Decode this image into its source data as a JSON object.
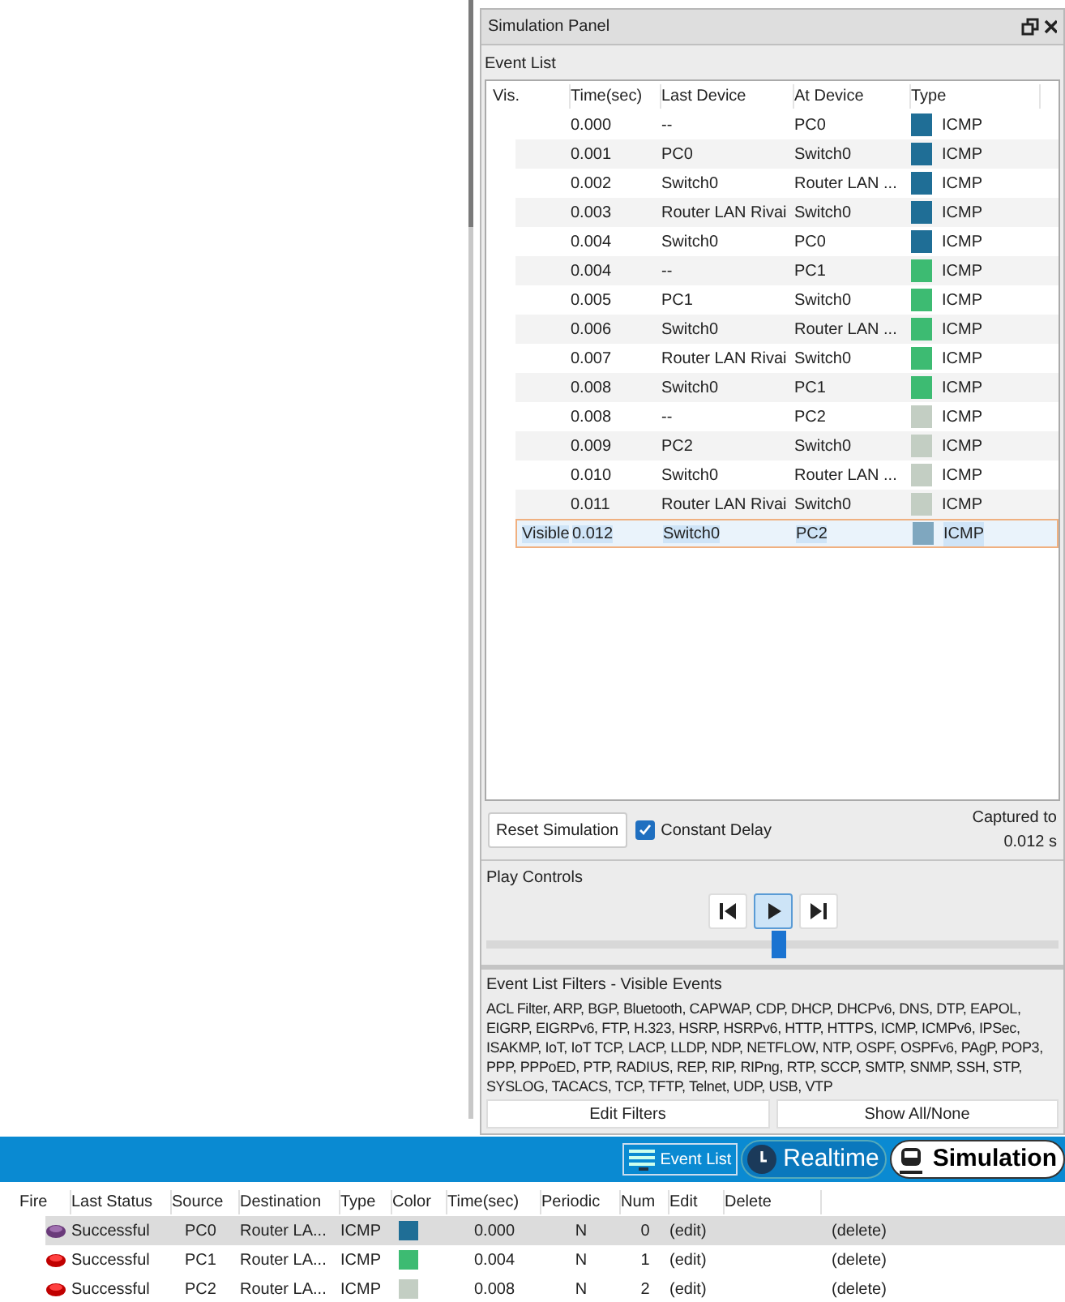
{
  "panel": {
    "title": "Simulation Panel"
  },
  "event_list": {
    "title": "Event List",
    "columns": [
      "Vis.",
      "Time(sec)",
      "Last Device",
      "At Device",
      "Type"
    ],
    "rows": [
      {
        "time": "0.000",
        "last": "--",
        "at": "PC0",
        "color": "#1f6e96",
        "type": "ICMP",
        "selected": false
      },
      {
        "time": "0.001",
        "last": "PC0",
        "at": "Switch0",
        "color": "#1f6e96",
        "type": "ICMP",
        "selected": false
      },
      {
        "time": "0.002",
        "last": "Switch0",
        "at": "Router LAN ...",
        "color": "#1f6e96",
        "type": "ICMP",
        "selected": false
      },
      {
        "time": "0.003",
        "last": "Router LAN Rivai",
        "at": "Switch0",
        "color": "#1f6e96",
        "type": "ICMP",
        "selected": false
      },
      {
        "time": "0.004",
        "last": "Switch0",
        "at": "PC0",
        "color": "#1f6e96",
        "type": "ICMP",
        "selected": false
      },
      {
        "time": "0.004",
        "last": "--",
        "at": "PC1",
        "color": "#3dbb72",
        "type": "ICMP",
        "selected": false
      },
      {
        "time": "0.005",
        "last": "PC1",
        "at": "Switch0",
        "color": "#3dbb72",
        "type": "ICMP",
        "selected": false
      },
      {
        "time": "0.006",
        "last": "Switch0",
        "at": "Router LAN ...",
        "color": "#3dbb72",
        "type": "ICMP",
        "selected": false
      },
      {
        "time": "0.007",
        "last": "Router LAN Rivai",
        "at": "Switch0",
        "color": "#3dbb72",
        "type": "ICMP",
        "selected": false
      },
      {
        "time": "0.008",
        "last": "Switch0",
        "at": "PC1",
        "color": "#3dbb72",
        "type": "ICMP",
        "selected": false
      },
      {
        "time": "0.008",
        "last": "--",
        "at": "PC2",
        "color": "#c3cec3",
        "type": "ICMP",
        "selected": false
      },
      {
        "time": "0.009",
        "last": "PC2",
        "at": "Switch0",
        "color": "#c3cec3",
        "type": "ICMP",
        "selected": false
      },
      {
        "time": "0.010",
        "last": "Switch0",
        "at": "Router LAN ...",
        "color": "#c3cec3",
        "type": "ICMP",
        "selected": false
      },
      {
        "time": "0.011",
        "last": "Router LAN Rivai",
        "at": "Switch0",
        "color": "#c3cec3",
        "type": "ICMP",
        "selected": false
      },
      {
        "vis": "Visible",
        "time": "0.012",
        "last": "Switch0",
        "at": "PC2",
        "color": "#7fa7bf",
        "type": "ICMP",
        "selected": true
      }
    ]
  },
  "reset_button": "Reset Simulation",
  "constant_delay": {
    "label": "Constant Delay",
    "checked": true
  },
  "captured": [
    "Captured to",
    "0.012 s"
  ],
  "play_controls": {
    "title": "Play Controls",
    "buttons": [
      {
        "kind": "back",
        "selected": false
      },
      {
        "kind": "play",
        "selected": true
      },
      {
        "kind": "forward",
        "selected": false
      }
    ],
    "level": 0.51
  },
  "filters": {
    "title": "Event List Filters - Visible Events",
    "text": "ACL Filter, ARP, BGP, Bluetooth, CAPWAP, CDP, DHCP, DHCPv6, DNS, DTP, EAPOL, EIGRP, EIGRPv6, FTP, H.323, HSRP, HSRPv6, HTTP, HTTPS, ICMP, ICMPv6, IPSec, ISAKMP, IoT, IoT TCP, LACP, LLDP, NDP, NETFLOW, NTP, OSPF, OSPFv6, PAgP, POP3, PPP, PPPoED, PTP, RADIUS, REP, RIP, RIPng, RTP, SCCP, SMTP, SNMP, SSH, STP, SYSLOG, TACACS, TCP, TFTP, Telnet, UDP, USB, VTP",
    "buttons": [
      "Edit Filters",
      "Show All/None"
    ]
  },
  "mode_bar": {
    "event_list_button": "Event List",
    "tabs": [
      {
        "label": "Realtime",
        "kind": "realtime",
        "selected": false
      },
      {
        "label": "Simulation",
        "kind": "simulation",
        "selected": true
      }
    ]
  },
  "pdu_table": {
    "columns": [
      "Fire",
      "Last Status",
      "Source",
      "Destination",
      "Type",
      "Color",
      "Time(sec)",
      "Periodic",
      "Num",
      "Edit",
      "Delete"
    ],
    "rows": [
      {
        "status": "Successful",
        "source": "PC0",
        "destination": "Router LA...",
        "type": "ICMP",
        "color": "#1f6e96",
        "time": "0.000",
        "periodic": "N",
        "num": "0",
        "edit": "(edit)",
        "delete": "(delete)",
        "selected": true
      },
      {
        "status": "Successful",
        "source": "PC1",
        "destination": "Router LA...",
        "type": "ICMP",
        "color": "#3dbb72",
        "time": "0.004",
        "periodic": "N",
        "num": "1",
        "edit": "(edit)",
        "delete": "(delete)",
        "selected": false
      },
      {
        "status": "Successful",
        "source": "PC2",
        "destination": "Router LA...",
        "type": "ICMP",
        "color": "#c3cec3",
        "time": "0.008",
        "periodic": "N",
        "num": "2",
        "edit": "(edit)",
        "delete": "(delete)",
        "selected": false
      }
    ]
  }
}
